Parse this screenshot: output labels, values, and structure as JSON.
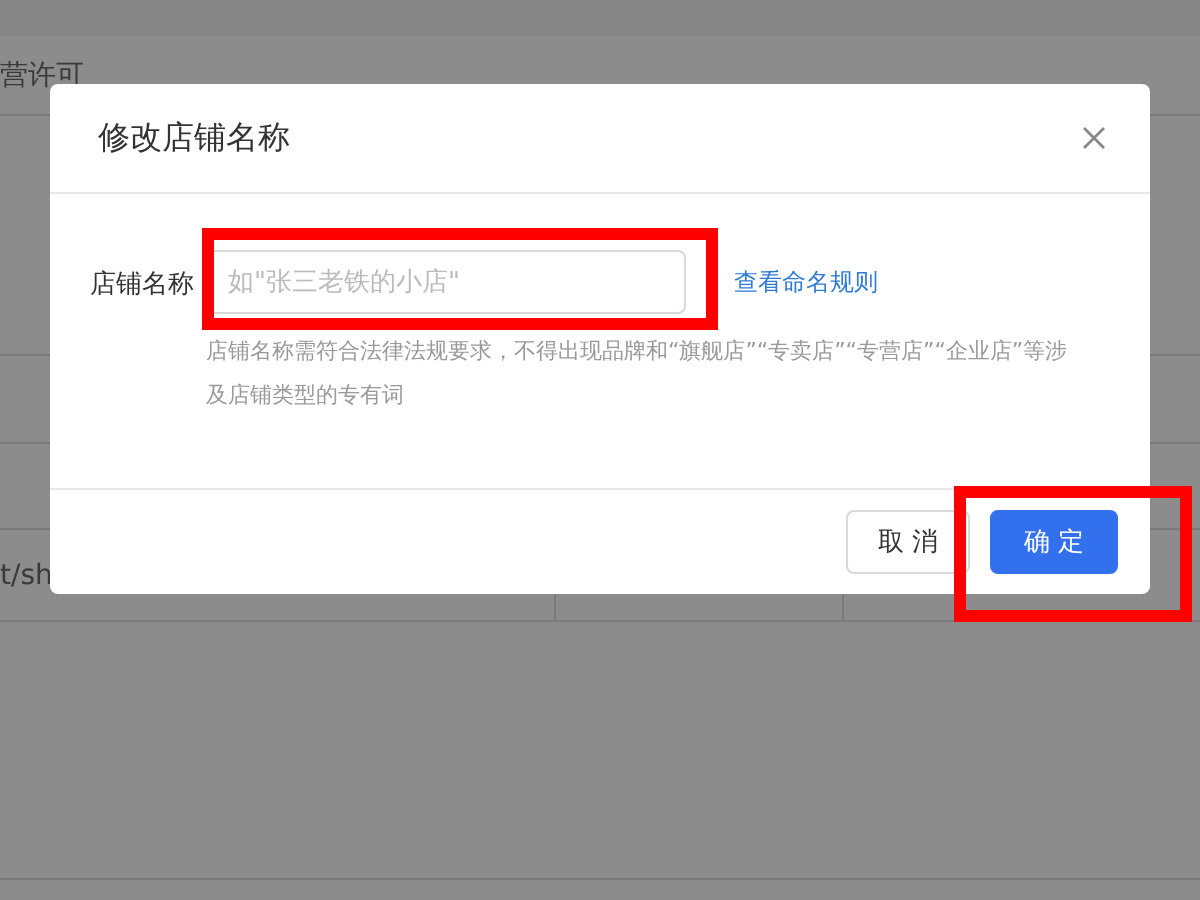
{
  "background": {
    "header_cells": [
      "营许可"
    ],
    "row_cells": [
      "t/sh"
    ]
  },
  "dialog": {
    "title": "修改店铺名称",
    "field": {
      "label": "店铺名称",
      "placeholder": "如\"张三老铁的小店\"",
      "link": "查看命名规则",
      "hint": "店铺名称需符合法律法规要求，不得出现品牌和“旗舰店”“专卖店”“专营店”“企业店”等涉及店铺类型的专有词"
    },
    "buttons": [
      {
        "label": "取 消",
        "kind": "default"
      },
      {
        "label": "确 定",
        "kind": "primary"
      }
    ]
  }
}
